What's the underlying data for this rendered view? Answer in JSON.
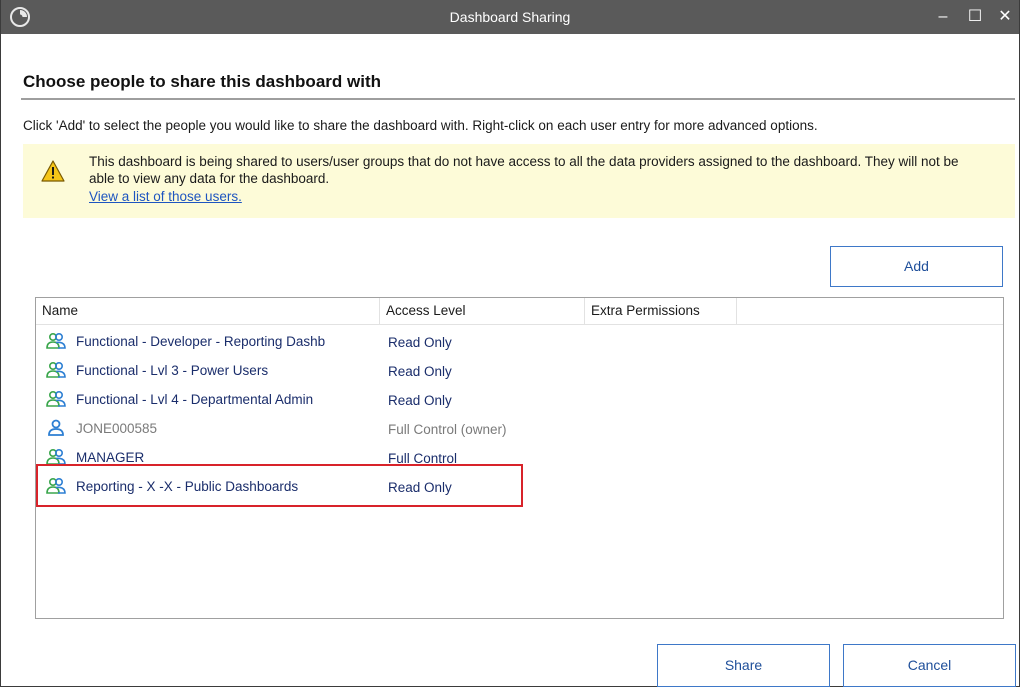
{
  "window": {
    "title": "Dashboard Sharing",
    "minimize_glyph": "–",
    "maximize_glyph": "☐",
    "close_glyph": "✕"
  },
  "heading": "Choose people to share this dashboard with",
  "instruction": "Click 'Add' to select the people you would like to share the dashboard with. Right-click on each user entry for more advanced options.",
  "warning": {
    "text": "This dashboard is being shared to users/user groups that do not have access to all the data providers assigned to the dashboard. They will not be able to view any data for the dashboard.",
    "link": "View a list of those users."
  },
  "buttons": {
    "add": "Add",
    "share": "Share",
    "cancel": "Cancel"
  },
  "list": {
    "columns": [
      "Name",
      "Access Level",
      "Extra Permissions"
    ],
    "rows": [
      {
        "name": "Functional - Developer - Reporting Dashb",
        "access": "Read Only",
        "icon": "group-icon"
      },
      {
        "name": "Functional - Lvl 3 - Power Users",
        "access": "Read Only",
        "icon": "group-icon"
      },
      {
        "name": "Functional - Lvl 4 - Departmental Admin",
        "access": "Read Only",
        "icon": "group-icon"
      },
      {
        "name": "JONE000585",
        "access": "Full Control  (owner)",
        "icon": "user-icon"
      },
      {
        "name": "MANAGER",
        "access": "Full Control",
        "icon": "group-icon"
      },
      {
        "name": "Reporting - X -X - Public Dashboards",
        "access": "Read Only",
        "icon": "group-icon"
      }
    ]
  },
  "colors": {
    "titlebar": "#5a5a5a",
    "accent_blue": "#3e78c8",
    "highlight_red": "#d8232a",
    "warning_bg": "#fdfbd8"
  }
}
